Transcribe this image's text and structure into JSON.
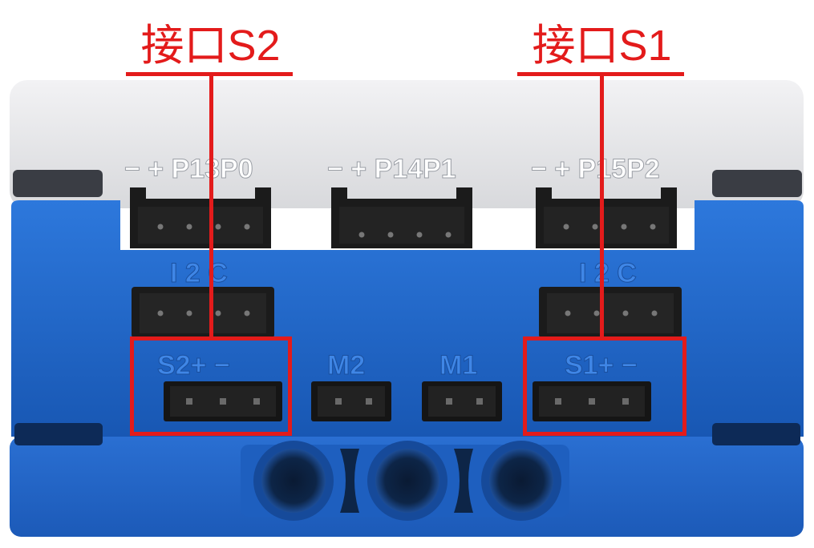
{
  "callouts": {
    "left": "接口S2",
    "right": "接口S1"
  },
  "device": {
    "top_ports": [
      {
        "label": "−  +  P13P0"
      },
      {
        "label": "−  +  P14P1"
      },
      {
        "label": "−  +  P15P2"
      }
    ],
    "i2c_left": "I 2 C",
    "i2c_right": "I 2 C",
    "s2_label": "S2+ −",
    "m2_label": "M2",
    "m1_label": "M1",
    "s1_label": "S1+ −"
  },
  "colors": {
    "annotation": "#e31b1b",
    "body_blue": "#1f63c6",
    "body_white": "#e9eaec",
    "connector": "#161616"
  }
}
